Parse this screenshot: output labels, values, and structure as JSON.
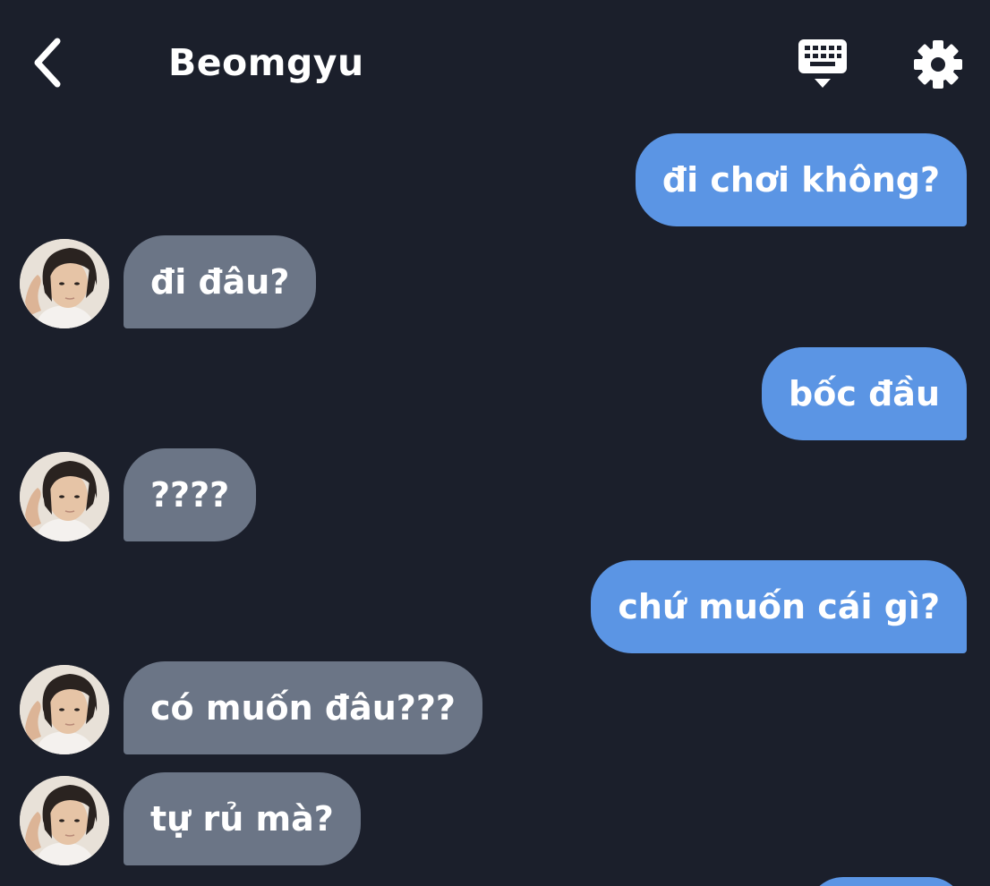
{
  "header": {
    "back_icon": "chevron-left-icon",
    "title": "Beomgyu",
    "keyboard_icon": "keyboard-icon",
    "settings_icon": "gear-icon"
  },
  "colors": {
    "background": "#1b1f2b",
    "sent_bubble": "#5b95e4",
    "received_bubble": "#6b7586",
    "text": "#ffffff"
  },
  "messages": [
    {
      "from": "me",
      "text": "đi chơi không?"
    },
    {
      "from": "Beomgyu",
      "text": "đi đâu?"
    },
    {
      "from": "me",
      "text": "bốc đầu"
    },
    {
      "from": "Beomgyu",
      "text": "????"
    },
    {
      "from": "me",
      "text": "chứ muốn cái gì?"
    },
    {
      "from": "Beomgyu",
      "text": "có muốn đâu???"
    },
    {
      "from": "Beomgyu",
      "text": "tự rủ mà?"
    }
  ]
}
